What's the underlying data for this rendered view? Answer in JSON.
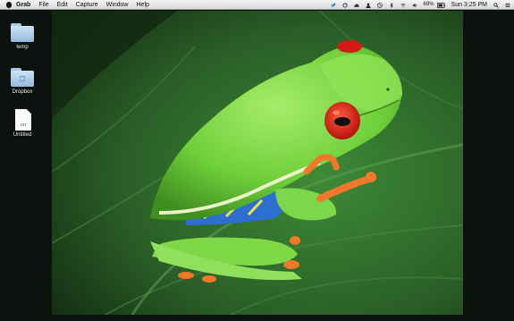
{
  "menubar": {
    "app_name": "Grab",
    "menus": [
      "File",
      "Edit",
      "Capture",
      "Window",
      "Help"
    ],
    "status": {
      "battery_percent": "69%",
      "clock": "Sun 3:25 PM"
    },
    "icons": [
      "twitter-icon",
      "sync-icon",
      "cloud-icon",
      "user-icon",
      "time-machine-icon",
      "bluetooth-icon",
      "wifi-icon",
      "volume-icon",
      "battery-icon",
      "spotlight-icon",
      "notifications-icon"
    ]
  },
  "desktop": {
    "icons": [
      {
        "label": "temp",
        "kind": "folder-icon"
      },
      {
        "label": "Dropbox",
        "kind": "dropbox-folder-icon"
      },
      {
        "label": "Untitled",
        "kind": "text-document-icon",
        "tag": "TXT"
      }
    ],
    "wallpaper": "red-eyed tree frog on a green leaf"
  },
  "colors": {
    "frog_green": "#74d23f",
    "eye_red": "#e1251b",
    "leaf_green": "#2f6a2a",
    "background": "#0c130e"
  }
}
